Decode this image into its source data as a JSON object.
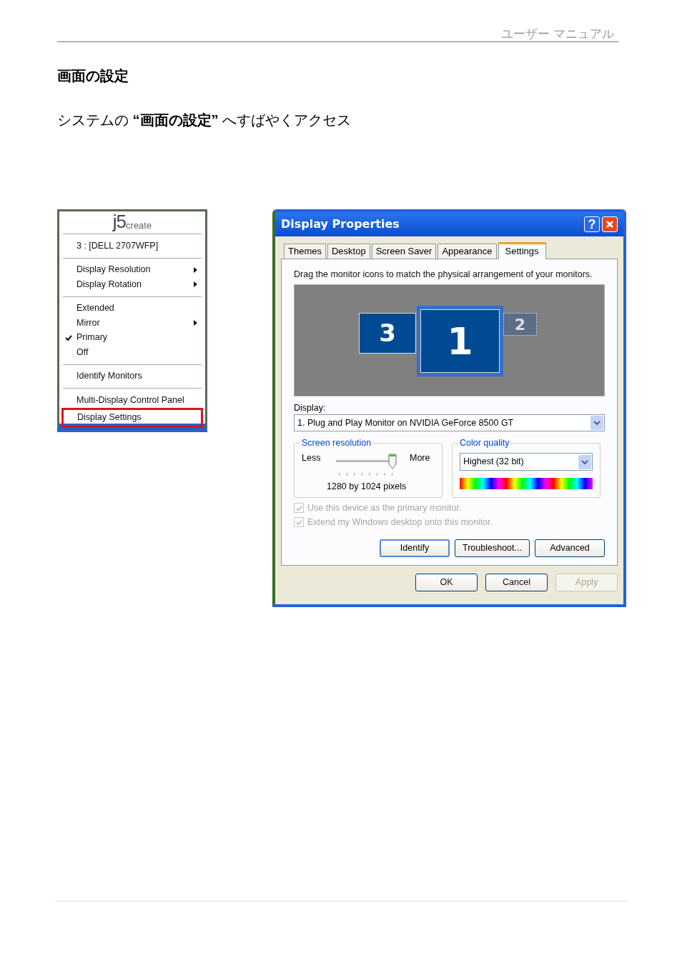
{
  "header": {
    "title": "ユーザー マニュアル"
  },
  "heading": "画面の設定",
  "intro": "システムの **“画面の設定”** へすばやくアクセス",
  "menu": {
    "logo_main": "j5",
    "logo_sub": "create",
    "sections": [
      [
        {
          "label": "3 : [DELL 2707WFP]",
          "submenu": false,
          "checked": false,
          "highlighted": false
        }
      ],
      [
        {
          "label": "Display Resolution",
          "submenu": true,
          "checked": false,
          "highlighted": false
        },
        {
          "label": "Display Rotation",
          "submenu": true,
          "checked": false,
          "highlighted": false
        }
      ],
      [
        {
          "label": "Extended",
          "submenu": false,
          "checked": false,
          "highlighted": false
        },
        {
          "label": "Mirror",
          "submenu": true,
          "checked": false,
          "highlighted": false
        },
        {
          "label": "Primary",
          "submenu": false,
          "checked": true,
          "highlighted": false
        },
        {
          "label": "Off",
          "submenu": false,
          "checked": false,
          "highlighted": false
        }
      ],
      [
        {
          "label": "Identify Monitors",
          "submenu": false,
          "checked": false,
          "highlighted": false
        }
      ],
      [
        {
          "label": "Multi-Display Control Panel",
          "submenu": false,
          "checked": false,
          "highlighted": false
        },
        {
          "label": "Display Settings",
          "submenu": false,
          "checked": false,
          "highlighted": true
        }
      ]
    ]
  },
  "dialog": {
    "title": "Display Properties",
    "help": "?",
    "tabs": [
      {
        "label": "Themes",
        "selected": false
      },
      {
        "label": "Desktop",
        "selected": false
      },
      {
        "label": "Screen Saver",
        "selected": false
      },
      {
        "label": "Appearance",
        "selected": false
      },
      {
        "label": "Settings",
        "selected": true
      }
    ],
    "instruction": "Drag the monitor icons to match the physical arrangement of your monitors.",
    "monitors": [
      {
        "label": "3",
        "selected": false,
        "attached": true
      },
      {
        "label": "1",
        "selected": true,
        "attached": true
      },
      {
        "label": "2",
        "selected": false,
        "attached": false
      }
    ],
    "display_label": "Display:",
    "display_value": "1. Plug and Play Monitor on NVIDIA GeForce 8500 GT",
    "resolution": {
      "legend": "Screen resolution",
      "less": "Less",
      "more": "More",
      "level": 1.0,
      "reading": "1280 by 1024 pixels"
    },
    "color": {
      "legend": "Color quality",
      "value": "Highest (32 bit)"
    },
    "checkboxes": [
      {
        "label": "Use this device as the primary monitor.",
        "checked": true,
        "disabled": true
      },
      {
        "label": "Extend my Windows desktop onto this monitor.",
        "checked": true,
        "disabled": true
      }
    ],
    "panel_buttons": [
      {
        "label": "Identify",
        "default": true
      },
      {
        "label": "Troubleshoot...",
        "default": false
      },
      {
        "label": "Advanced",
        "default": false
      }
    ],
    "buttons": [
      {
        "label": "OK",
        "disabled": false
      },
      {
        "label": "Cancel",
        "disabled": false
      },
      {
        "label": "Apply",
        "disabled": true
      }
    ]
  }
}
